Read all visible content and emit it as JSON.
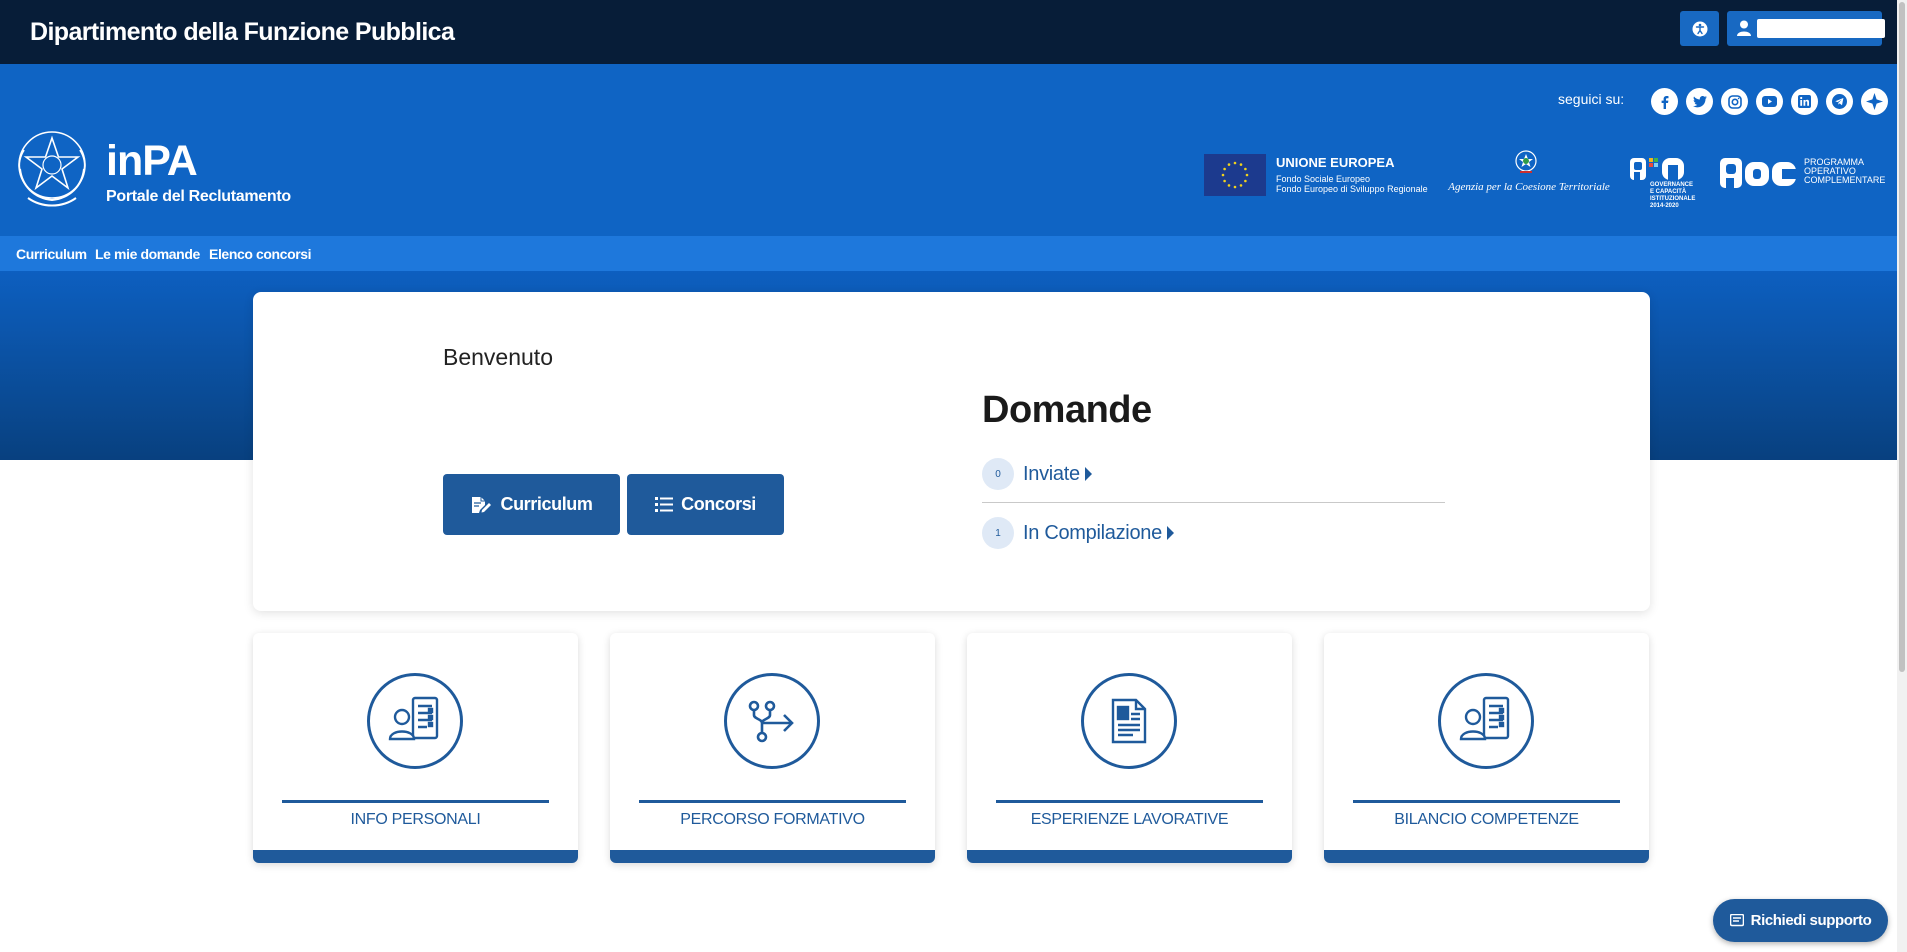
{
  "topbar": {
    "org_name": "Dipartimento della Funzione Pubblica",
    "accessibility_icon": "accessibility-icon",
    "user_icon": "user-icon"
  },
  "header": {
    "follow_label": "seguici su:",
    "social": [
      "facebook-icon",
      "twitter-icon",
      "instagram-icon",
      "youtube-icon",
      "linkedin-icon",
      "telegram-icon",
      "star-icon"
    ],
    "brand": "inPA",
    "brand_subtitle": "Portale del Reclutamento",
    "eu": {
      "title": "UNIONE EUROPEA",
      "line1": "Fondo Sociale Europeo",
      "line2": "Fondo Europeo di Sviluppo Regionale"
    },
    "agency": "Agenzia per la Coesione Territoriale",
    "pon": {
      "name": "PON",
      "subtitle": "GOVERNANCE E CAPACITÀ ISTITUZIONALE 2014-2020"
    },
    "poc": {
      "name": "POC",
      "subtitle": "PROGRAMMA OPERATIVO COMPLEMENTARE"
    }
  },
  "nav": {
    "items": [
      "Curriculum",
      "Le mie domande",
      "Elenco concorsi"
    ]
  },
  "welcome": {
    "greeting": "Benvenuto",
    "buttons": {
      "curriculum": "Curriculum",
      "concorsi": "Concorsi"
    },
    "domande": {
      "title": "Domande",
      "rows": [
        {
          "count": "0",
          "label": "Inviate"
        },
        {
          "count": "1",
          "label": "In Compilazione"
        }
      ]
    }
  },
  "tiles": [
    {
      "label": "INFO PERSONALI",
      "icon": "person-document-icon"
    },
    {
      "label": "PERCORSO FORMATIVO",
      "icon": "path-arrow-icon"
    },
    {
      "label": "ESPERIENZE LAVORATIVE",
      "icon": "document-icon"
    },
    {
      "label": "BILANCIO COMPETENZE",
      "icon": "person-document-icon"
    }
  ],
  "support": {
    "label": "Richiedi supporto",
    "icon": "chat-icon"
  },
  "colors": {
    "topbar": "#071d38",
    "header": "#0f64c4",
    "nav": "#1e78dc",
    "primary": "#1f5a9b"
  }
}
